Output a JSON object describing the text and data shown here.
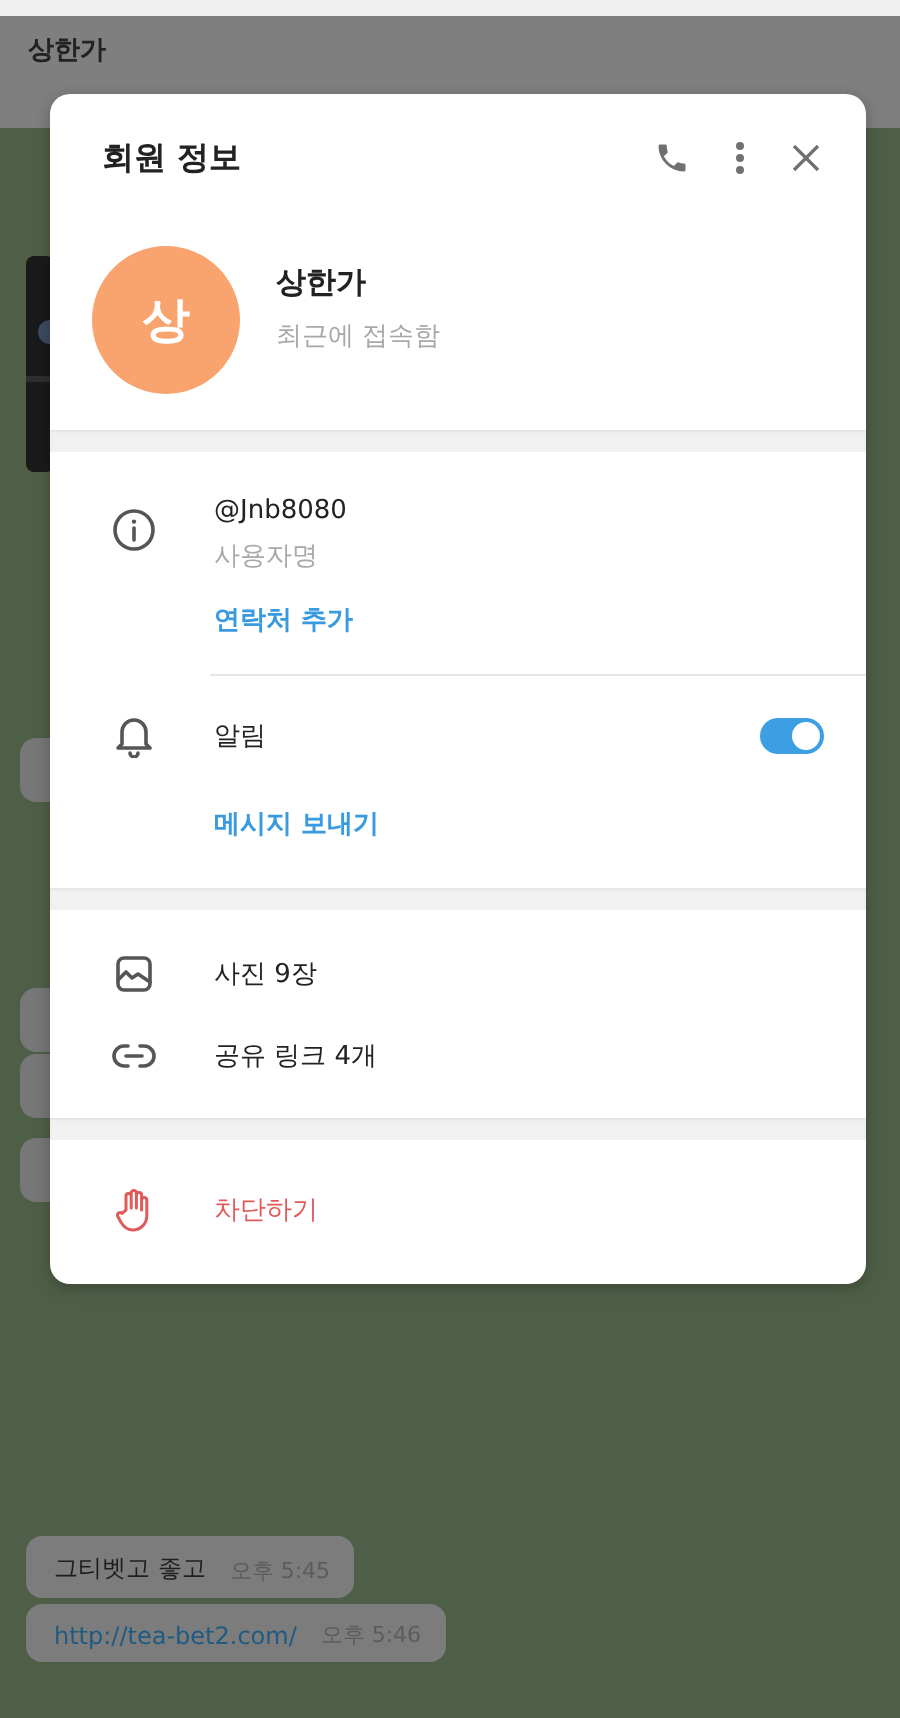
{
  "chat_header": {
    "title": "상한가"
  },
  "dialog": {
    "title": "회원 정보",
    "profile": {
      "initial": "상",
      "name": "상한가",
      "status": "최근에 접속함",
      "color": "#f9a46e"
    },
    "info": {
      "username": "@Jnb8080",
      "username_caption": "사용자명",
      "add_contact": "연락처 추가"
    },
    "notifications": {
      "label": "알림",
      "on": true
    },
    "send_message": "메시지 보내기",
    "media": [
      {
        "kind": "photos",
        "label": "사진 9장"
      },
      {
        "kind": "links",
        "label": "공유 링크 4개"
      }
    ],
    "block": {
      "label": "차단하기"
    }
  },
  "messages": [
    {
      "kind": "text",
      "text": "그티벳고 좋고",
      "time": "오후 5:45"
    },
    {
      "kind": "link",
      "text": "http://tea-bet2.com/",
      "time": "오후 5:46"
    }
  ]
}
